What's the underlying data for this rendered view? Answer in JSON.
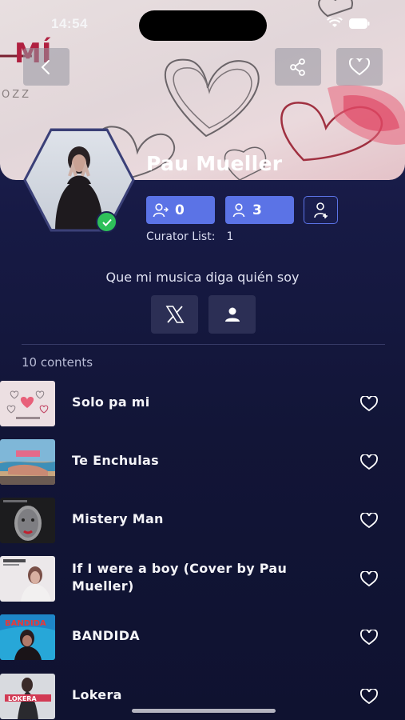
{
  "status_bar": {
    "time": "14:54"
  },
  "header": {
    "back_icon": "chevron-left-icon",
    "share_icon": "share-icon",
    "favorite_icon": "heart-icon"
  },
  "artist": {
    "name": "Pau Mueller",
    "verified": true,
    "following_count": "0",
    "followers_count": "3",
    "curator_label": "Curator List:",
    "curator_count": "1",
    "bio": "Que mi musica diga quién soy"
  },
  "social": {
    "x_icon": "x-logo-icon",
    "profile_icon": "person-icon"
  },
  "contents": {
    "count_label": "10 contents",
    "tracks": [
      {
        "title": "Solo pa mi"
      },
      {
        "title": "Te Enchulas"
      },
      {
        "title": "Mistery Man"
      },
      {
        "title": "If I were a boy (Cover by Pau Mueller)"
      },
      {
        "title": "BANDIDA"
      },
      {
        "title": "Lokera"
      }
    ]
  },
  "colors": {
    "accent": "#5b73e6",
    "verified": "#2ec05a",
    "background": "#151840"
  }
}
